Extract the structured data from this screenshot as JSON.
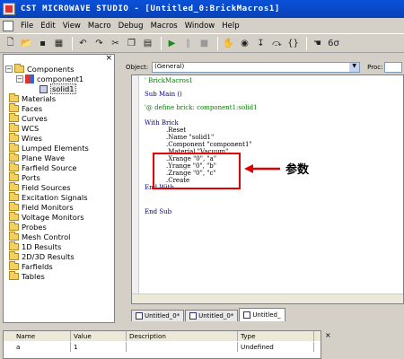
{
  "window": {
    "title": "CST MICROWAVE STUDIO - [Untitled_0:BrickMacros1]"
  },
  "menu": [
    "File",
    "Edit",
    "View",
    "Macro",
    "Debug",
    "Macros",
    "Window",
    "Help"
  ],
  "toolbar": {
    "icons": [
      "new-icon",
      "open-icon",
      "save-icon",
      "print-icon",
      "undo-icon",
      "redo-icon",
      "cut-icon",
      "copy-icon",
      "paste-icon",
      "run-icon",
      "pause-icon",
      "stop-icon",
      "hand-icon",
      "watch-icon",
      "step-icon",
      "step-over-icon",
      "step-out-icon",
      "breakpoint-icon",
      "variables-icon"
    ]
  },
  "tree": {
    "close_label": "×",
    "root": "Components",
    "component": "component1",
    "solid": "solid1",
    "folders": [
      "Materials",
      "Faces",
      "Curves",
      "WCS",
      "Wires",
      "Lumped Elements",
      "Plane Wave",
      "Farfield Source",
      "Ports",
      "Field Sources",
      "Excitation Signals",
      "Field Monitors",
      "Voltage Monitors",
      "Probes",
      "Mesh Control",
      "1D Results",
      "2D/3D Results",
      "Farfields",
      "Tables"
    ]
  },
  "editor": {
    "object_label": "Object:",
    "object_value": "(General)",
    "proc_label": "Proc:",
    "lines": [
      "' BrickMacros1",
      "Sub Main ()",
      "'@ define brick: component1:solid1",
      "With Brick",
      ".Reset",
      ".Name \"solid1\"",
      ".Component \"component1\"",
      ".Material \"Vacuum\"",
      ".Xrange \"0\", \"a\"",
      ".Yrange \"0\", \"b\"",
      ".Zrange \"0\", \"c\"",
      ".Create",
      "End With",
      "End Sub"
    ],
    "annotation": "参数"
  },
  "editor_tabs": [
    "Untitled_0*",
    "Untitled_0*",
    "Untitled_"
  ],
  "variables": {
    "headers": [
      "Name",
      "Value",
      "Description",
      "Type"
    ],
    "rows": [
      {
        "name": "a",
        "value": "1",
        "description": "",
        "type": "Undefined"
      }
    ]
  }
}
